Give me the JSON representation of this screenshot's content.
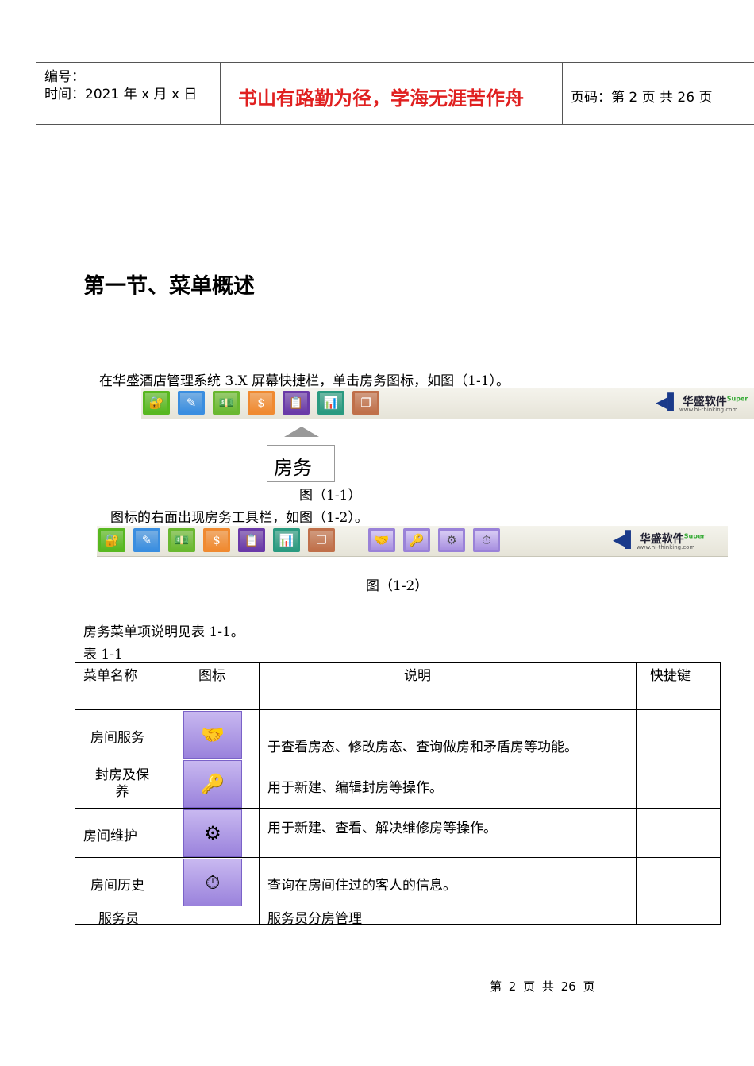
{
  "header": {
    "number_label": "编号：",
    "time_label": "时间：2021 年 x 月 x 日",
    "motto": "书山有路勤为径，学海无涯苦作舟",
    "page_label": "页码：第 2 页  共 26 页"
  },
  "section_title": "第一节、菜单概述",
  "para1": "在华盛酒店管理系统  3.X 屏幕快捷栏，单击房务图标，如图（1-1）。",
  "callout_label": "房务",
  "fig1_caption": "图（1-1）",
  "para2": "图标的右面出现房务工具栏，如图（1-2）。",
  "fig2_caption": "图（1-2）",
  "logo": {
    "name": "华盛软件",
    "super": "Super",
    "url": "www.hi-thinking.com"
  },
  "toolbar_icons": [
    {
      "icon": "lock-key-icon",
      "color": "#58b820",
      "glyph": "🔐"
    },
    {
      "icon": "edit-icon",
      "color": "#3a8ee0",
      "glyph": "✎"
    },
    {
      "icon": "money-stack-icon",
      "color": "#6ab830",
      "glyph": "💵"
    },
    {
      "icon": "billing-icon",
      "color": "#f08a30",
      "glyph": "$"
    },
    {
      "icon": "housekeeping-icon",
      "color": "#6a3aa8",
      "glyph": "📋"
    },
    {
      "icon": "report-chart-icon",
      "color": "#2a9a80",
      "glyph": "📊"
    },
    {
      "icon": "windows-icon",
      "color": "#c0704a",
      "glyph": "❐"
    }
  ],
  "room_icons": [
    {
      "icon": "room-service-icon",
      "glyph": "🤝"
    },
    {
      "icon": "room-seal-icon",
      "glyph": "🔑"
    },
    {
      "icon": "room-maintenance-icon",
      "glyph": "⚙"
    },
    {
      "icon": "room-history-icon",
      "glyph": "⏱"
    }
  ],
  "para3": "房务菜单项说明见表 1-1。",
  "table_label": "表 1-1",
  "table": {
    "headers": [
      "菜单名称",
      "图标",
      "说明",
      "快捷键"
    ],
    "rows": [
      {
        "name": "房间服务",
        "desc": "于查看房态、修改房态、查询做房和矛盾房等功能。",
        "shortcut": ""
      },
      {
        "name": "封房及保养",
        "desc": "用于新建、编辑封房等操作。",
        "shortcut": ""
      },
      {
        "name": "房间维护",
        "desc": "用于新建、查看、解决维修房等操作。",
        "shortcut": ""
      },
      {
        "name": "房间历史",
        "desc": "查询在房间住过的客人的信息。",
        "shortcut": ""
      },
      {
        "name": "服务员",
        "desc": "服务员分房管理",
        "shortcut": ""
      }
    ]
  },
  "footer": "第 2 页 共 26 页"
}
